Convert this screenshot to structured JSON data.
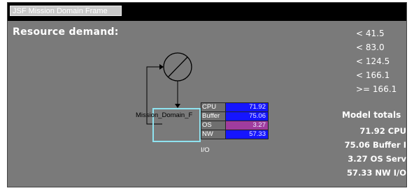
{
  "window": {
    "title": "JSF Mission Domain Frame"
  },
  "heading": "Resource demand:",
  "legend": [
    "< 41.5",
    "< 83.0",
    "< 124.5",
    "< 166.1",
    ">= 166.1"
  ],
  "node": {
    "label": "Mission_Domain_F"
  },
  "metrics": [
    {
      "label": "CPU",
      "value": "71.92",
      "color": "#1515ff"
    },
    {
      "label": "Buffer",
      "value": "75.06",
      "color": "#1515ff"
    },
    {
      "label": "OS",
      "value": "3.27",
      "color": "#a03c9e"
    },
    {
      "label": "NW",
      "value": "57.33",
      "color": "#1515ff"
    }
  ],
  "io_label": "I/O",
  "totals": {
    "heading": "Model totals",
    "rows": [
      "71.92  CPU",
      "75.06  Buffer I",
      "3.27  OS Serv",
      "57.33  NW I/O"
    ]
  }
}
